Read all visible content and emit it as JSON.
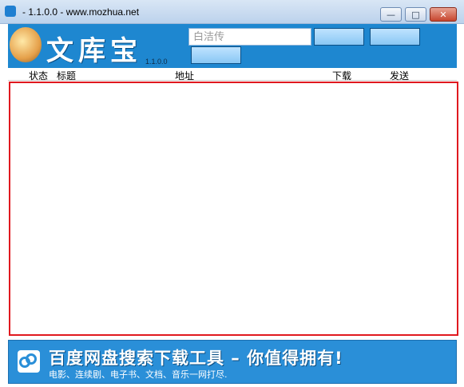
{
  "window": {
    "title": "- 1.1.0.0 - www.mozhua.net",
    "minimize_label": "—",
    "maximize_label": "□",
    "close_label": "✕"
  },
  "header": {
    "logo_text": "文库宝",
    "version": "1.1.0.0",
    "search_placeholder": "白洁传",
    "button1_label": "",
    "button2_label": "",
    "button3_label": ""
  },
  "table": {
    "columns": [
      "状态",
      "标题",
      "地址",
      "下载",
      "发送"
    ]
  },
  "banner": {
    "title": "百度网盘搜索下载工具 – 你值得拥有!",
    "subtitle": "电影、连续剧、电子书、文档、音乐一网打尽."
  },
  "colors": {
    "header_blue": "#1e87d0",
    "list_border_red": "#e0191f",
    "banner_blue": "#2a8fd8"
  }
}
